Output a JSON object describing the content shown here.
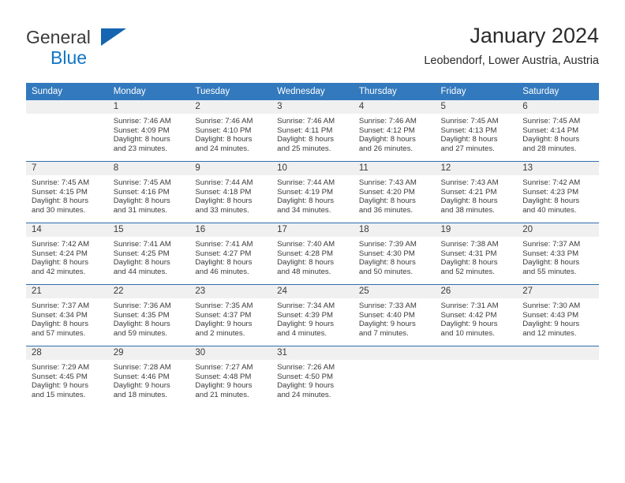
{
  "brand": {
    "line1": "General",
    "line2": "Blue",
    "triangle_color": "#1565b0",
    "blue_text_color": "#1275c5"
  },
  "header": {
    "title": "January 2024",
    "subtitle": "Leobendorf, Lower Austria, Austria"
  },
  "theme": {
    "header_row_bg": "#3379bd",
    "row_separator": "#2f6fae",
    "daynum_band_bg": "#f0f0f0",
    "text_color": "#3a3a3a"
  },
  "weekday_headers": [
    "Sunday",
    "Monday",
    "Tuesday",
    "Wednesday",
    "Thursday",
    "Friday",
    "Saturday"
  ],
  "labels": {
    "sunrise_prefix": "Sunrise:",
    "sunset_prefix": "Sunset:",
    "daylight_prefix": "Daylight:"
  },
  "weeks": [
    [
      {
        "empty": true
      },
      {
        "day": "1",
        "line1": "Sunrise: 7:46 AM",
        "line2": "Sunset: 4:09 PM",
        "line3": "Daylight: 8 hours",
        "line4": "and 23 minutes."
      },
      {
        "day": "2",
        "line1": "Sunrise: 7:46 AM",
        "line2": "Sunset: 4:10 PM",
        "line3": "Daylight: 8 hours",
        "line4": "and 24 minutes."
      },
      {
        "day": "3",
        "line1": "Sunrise: 7:46 AM",
        "line2": "Sunset: 4:11 PM",
        "line3": "Daylight: 8 hours",
        "line4": "and 25 minutes."
      },
      {
        "day": "4",
        "line1": "Sunrise: 7:46 AM",
        "line2": "Sunset: 4:12 PM",
        "line3": "Daylight: 8 hours",
        "line4": "and 26 minutes."
      },
      {
        "day": "5",
        "line1": "Sunrise: 7:45 AM",
        "line2": "Sunset: 4:13 PM",
        "line3": "Daylight: 8 hours",
        "line4": "and 27 minutes."
      },
      {
        "day": "6",
        "line1": "Sunrise: 7:45 AM",
        "line2": "Sunset: 4:14 PM",
        "line3": "Daylight: 8 hours",
        "line4": "and 28 minutes."
      }
    ],
    [
      {
        "day": "7",
        "line1": "Sunrise: 7:45 AM",
        "line2": "Sunset: 4:15 PM",
        "line3": "Daylight: 8 hours",
        "line4": "and 30 minutes."
      },
      {
        "day": "8",
        "line1": "Sunrise: 7:45 AM",
        "line2": "Sunset: 4:16 PM",
        "line3": "Daylight: 8 hours",
        "line4": "and 31 minutes."
      },
      {
        "day": "9",
        "line1": "Sunrise: 7:44 AM",
        "line2": "Sunset: 4:18 PM",
        "line3": "Daylight: 8 hours",
        "line4": "and 33 minutes."
      },
      {
        "day": "10",
        "line1": "Sunrise: 7:44 AM",
        "line2": "Sunset: 4:19 PM",
        "line3": "Daylight: 8 hours",
        "line4": "and 34 minutes."
      },
      {
        "day": "11",
        "line1": "Sunrise: 7:43 AM",
        "line2": "Sunset: 4:20 PM",
        "line3": "Daylight: 8 hours",
        "line4": "and 36 minutes."
      },
      {
        "day": "12",
        "line1": "Sunrise: 7:43 AM",
        "line2": "Sunset: 4:21 PM",
        "line3": "Daylight: 8 hours",
        "line4": "and 38 minutes."
      },
      {
        "day": "13",
        "line1": "Sunrise: 7:42 AM",
        "line2": "Sunset: 4:23 PM",
        "line3": "Daylight: 8 hours",
        "line4": "and 40 minutes."
      }
    ],
    [
      {
        "day": "14",
        "line1": "Sunrise: 7:42 AM",
        "line2": "Sunset: 4:24 PM",
        "line3": "Daylight: 8 hours",
        "line4": "and 42 minutes."
      },
      {
        "day": "15",
        "line1": "Sunrise: 7:41 AM",
        "line2": "Sunset: 4:25 PM",
        "line3": "Daylight: 8 hours",
        "line4": "and 44 minutes."
      },
      {
        "day": "16",
        "line1": "Sunrise: 7:41 AM",
        "line2": "Sunset: 4:27 PM",
        "line3": "Daylight: 8 hours",
        "line4": "and 46 minutes."
      },
      {
        "day": "17",
        "line1": "Sunrise: 7:40 AM",
        "line2": "Sunset: 4:28 PM",
        "line3": "Daylight: 8 hours",
        "line4": "and 48 minutes."
      },
      {
        "day": "18",
        "line1": "Sunrise: 7:39 AM",
        "line2": "Sunset: 4:30 PM",
        "line3": "Daylight: 8 hours",
        "line4": "and 50 minutes."
      },
      {
        "day": "19",
        "line1": "Sunrise: 7:38 AM",
        "line2": "Sunset: 4:31 PM",
        "line3": "Daylight: 8 hours",
        "line4": "and 52 minutes."
      },
      {
        "day": "20",
        "line1": "Sunrise: 7:37 AM",
        "line2": "Sunset: 4:33 PM",
        "line3": "Daylight: 8 hours",
        "line4": "and 55 minutes."
      }
    ],
    [
      {
        "day": "21",
        "line1": "Sunrise: 7:37 AM",
        "line2": "Sunset: 4:34 PM",
        "line3": "Daylight: 8 hours",
        "line4": "and 57 minutes."
      },
      {
        "day": "22",
        "line1": "Sunrise: 7:36 AM",
        "line2": "Sunset: 4:35 PM",
        "line3": "Daylight: 8 hours",
        "line4": "and 59 minutes."
      },
      {
        "day": "23",
        "line1": "Sunrise: 7:35 AM",
        "line2": "Sunset: 4:37 PM",
        "line3": "Daylight: 9 hours",
        "line4": "and 2 minutes."
      },
      {
        "day": "24",
        "line1": "Sunrise: 7:34 AM",
        "line2": "Sunset: 4:39 PM",
        "line3": "Daylight: 9 hours",
        "line4": "and 4 minutes."
      },
      {
        "day": "25",
        "line1": "Sunrise: 7:33 AM",
        "line2": "Sunset: 4:40 PM",
        "line3": "Daylight: 9 hours",
        "line4": "and 7 minutes."
      },
      {
        "day": "26",
        "line1": "Sunrise: 7:31 AM",
        "line2": "Sunset: 4:42 PM",
        "line3": "Daylight: 9 hours",
        "line4": "and 10 minutes."
      },
      {
        "day": "27",
        "line1": "Sunrise: 7:30 AM",
        "line2": "Sunset: 4:43 PM",
        "line3": "Daylight: 9 hours",
        "line4": "and 12 minutes."
      }
    ],
    [
      {
        "day": "28",
        "line1": "Sunrise: 7:29 AM",
        "line2": "Sunset: 4:45 PM",
        "line3": "Daylight: 9 hours",
        "line4": "and 15 minutes."
      },
      {
        "day": "29",
        "line1": "Sunrise: 7:28 AM",
        "line2": "Sunset: 4:46 PM",
        "line3": "Daylight: 9 hours",
        "line4": "and 18 minutes."
      },
      {
        "day": "30",
        "line1": "Sunrise: 7:27 AM",
        "line2": "Sunset: 4:48 PM",
        "line3": "Daylight: 9 hours",
        "line4": "and 21 minutes."
      },
      {
        "day": "31",
        "line1": "Sunrise: 7:26 AM",
        "line2": "Sunset: 4:50 PM",
        "line3": "Daylight: 9 hours",
        "line4": "and 24 minutes."
      },
      {
        "empty": true
      },
      {
        "empty": true
      },
      {
        "empty": true
      }
    ]
  ]
}
